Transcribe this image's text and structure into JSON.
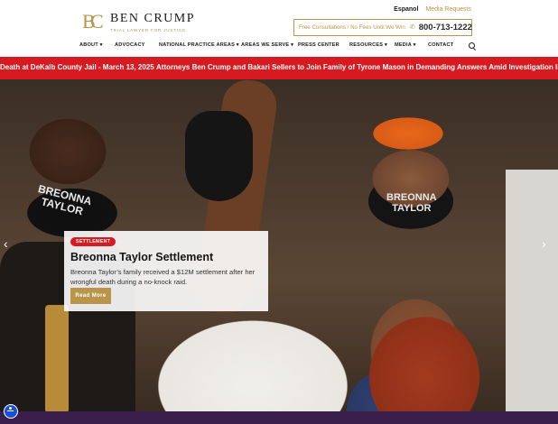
{
  "brand": {
    "logo_letters": [
      "B",
      "C"
    ],
    "name": "BEN CRUMP",
    "tagline": "TRIAL LAWYER FOR JUSTICE",
    "gold": "#b8954a"
  },
  "top_links": {
    "espanol": "Espanol",
    "media_requests": "Media Requests"
  },
  "consult": {
    "text": "Free Consultations / No Fees Until We Win",
    "icon": "phone-icon",
    "phone": "800-713-1222"
  },
  "nav": {
    "items": [
      {
        "label": "ABOUT ▾"
      },
      {
        "label": "ADVOCACY"
      },
      {
        "label": "NATIONAL PRACTICE AREAS ▾"
      },
      {
        "label": "AREAS WE SERVE ▾"
      },
      {
        "label": "PRESS CENTER"
      },
      {
        "label": "RESOURCES ▾"
      },
      {
        "label": "MEDIA ▾"
      },
      {
        "label": "CONTACT"
      }
    ],
    "search_icon": "search-icon"
  },
  "ticker": {
    "color": "#d71920",
    "items": [
      "Death at DeKalb County Jail - March 13, 2025",
      "Attorneys Ben Crump and Bakari Sellers to Join Family of Tyrone Mason in Demanding Answers Amid Investigation Into Highway Pa"
    ]
  },
  "hero": {
    "mask_left": "BREONNA\nTAYLOR",
    "mask_right": "BREONNA\nTAYLOR",
    "prev_icon": "chevron-left-icon",
    "next_icon": "chevron-right-icon",
    "card": {
      "badge": "SETTLEMENT",
      "title": "Breonna Taylor Settlement",
      "description": "Breonna Taylor’s family received a $12M settlement after her wrongful death during a no-knock raid.",
      "button": "Read More"
    }
  },
  "accessibility": {
    "icon": "accessibility-icon"
  }
}
